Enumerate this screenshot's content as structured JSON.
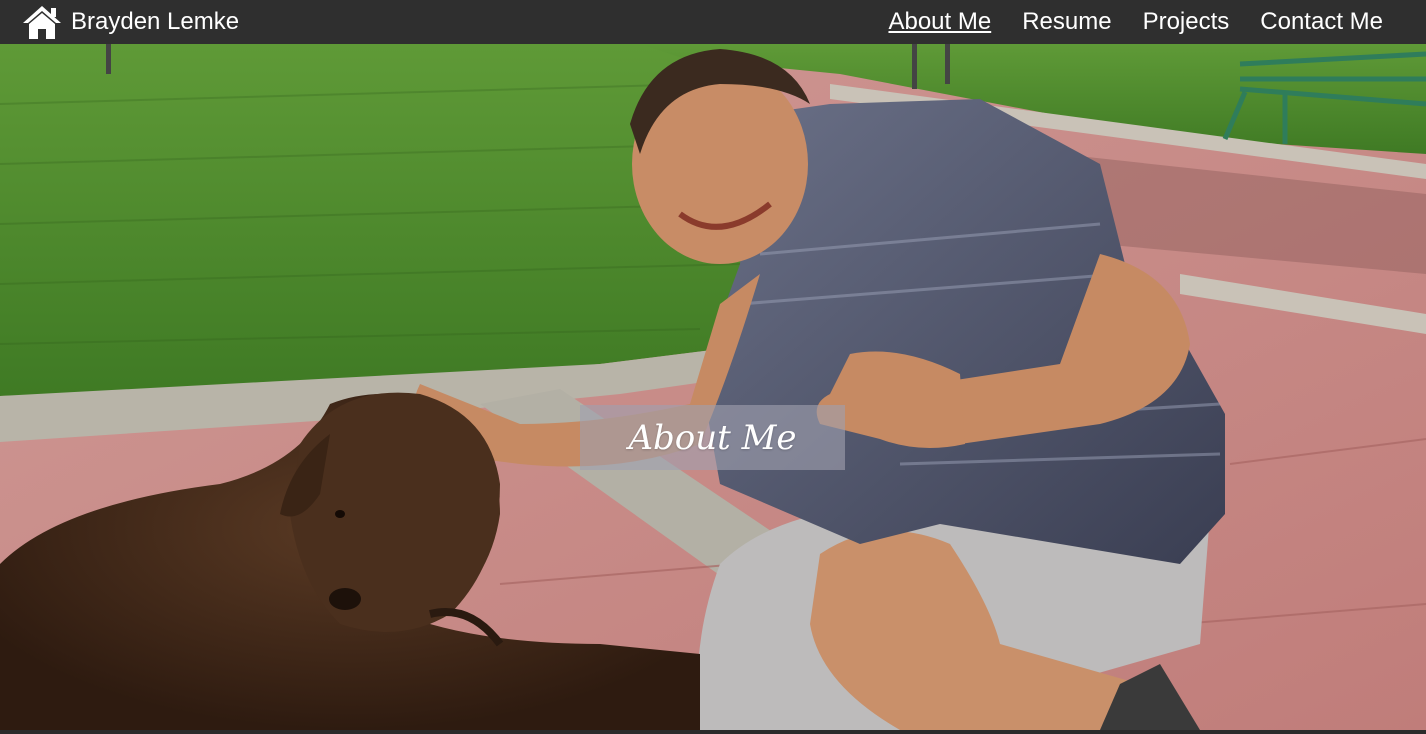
{
  "header": {
    "brand_name": "Brayden Lemke",
    "brand_icon": "home-icon"
  },
  "nav": {
    "items": [
      {
        "label": "About Me",
        "active": true
      },
      {
        "label": "Resume",
        "active": false
      },
      {
        "label": "Projects",
        "active": false
      },
      {
        "label": "Contact Me",
        "active": false
      }
    ]
  },
  "hero": {
    "caption": "About Me"
  },
  "colors": {
    "navbar_bg": "#2f2f2f",
    "nav_text": "#ffffff",
    "grass": "#4f8a2e",
    "path": "#c98885",
    "caption_bg": "rgba(160,160,175,0.62)"
  }
}
